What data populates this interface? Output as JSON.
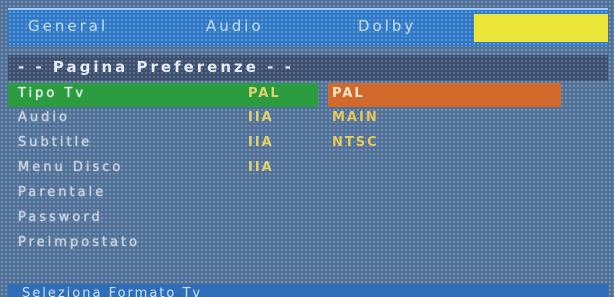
{
  "tabs": [
    {
      "label": "General"
    },
    {
      "label": "Audio"
    },
    {
      "label": "Dolby"
    }
  ],
  "page_title": "- - Pagina Preferenze - -",
  "rows": [
    {
      "label": "Tipo Tv",
      "value": "PAL",
      "option": "PAL",
      "selected": true
    },
    {
      "label": "Audio",
      "value": "IIA",
      "option": "MAIN"
    },
    {
      "label": "Subtitle",
      "value": "IIA",
      "option": "NTSC"
    },
    {
      "label": "Menu Disco",
      "value": "IIA"
    },
    {
      "label": "Parentale"
    },
    {
      "label": "Password"
    },
    {
      "label": "Preimpostato"
    }
  ],
  "status": "Seleziona Formato Tv",
  "colors": {
    "selected_row": "#2a9b3e",
    "option_highlight": "#d2692a",
    "tab_bar": "#2f78c6",
    "active_tab_fill": "#ece53a"
  }
}
